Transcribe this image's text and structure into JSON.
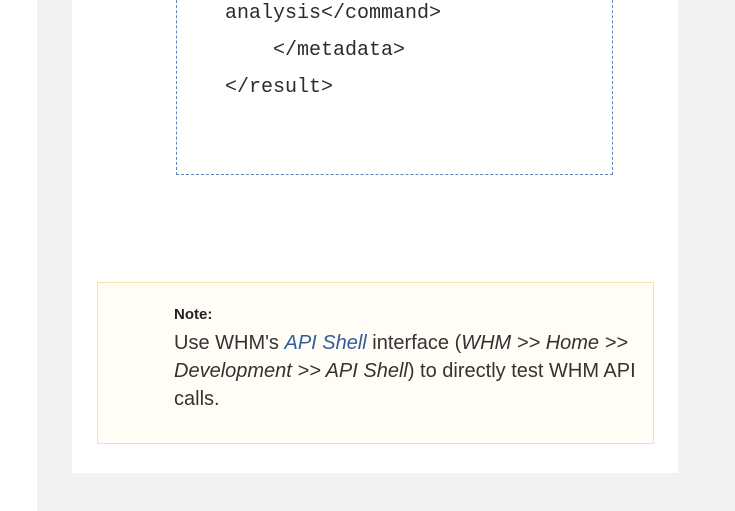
{
  "code": {
    "lines": [
      "analysis</command>",
      "    </metadata>",
      "</result>"
    ]
  },
  "note": {
    "title": "Note:",
    "text_before": "Use WHM's ",
    "link_text": "API Shell",
    "text_middle": " interface (",
    "path_text": "WHM >> Home >> Development >> API Shell",
    "text_after": ") to directly test WHM API calls."
  }
}
